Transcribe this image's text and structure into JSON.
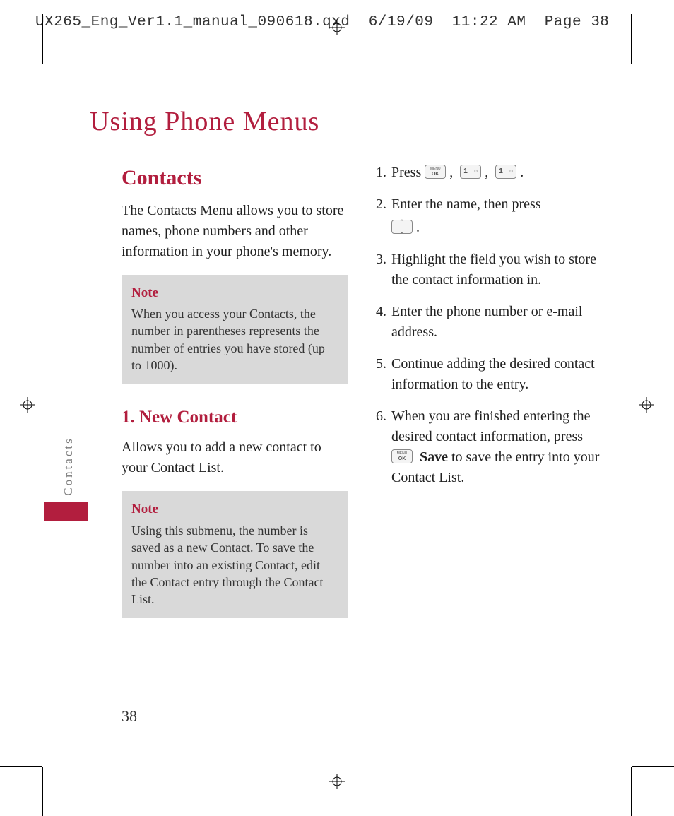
{
  "print_header": {
    "filename": "UX265_Eng_Ver1.1_manual_090618.qxd",
    "date": "6/19/09",
    "time": "11:22 AM",
    "page_label": "Page 38"
  },
  "chapter_title": "Using Phone Menus",
  "side_tab_label": "Contacts",
  "page_number": "38",
  "left_column": {
    "section_heading": "Contacts",
    "intro": "The Contacts Menu allows you to store names, phone numbers and other information in your phone's memory.",
    "note1_title": "Note",
    "note1_body": "When you access your Contacts, the number in parentheses represents the number of entries you have stored (up to 1000).",
    "subsection_heading": "1. New Contact",
    "subsection_intro": "Allows you to add a new contact to your Contact List.",
    "note2_title": "Note",
    "note2_body": "Using this submenu, the number is saved as a new Contact. To save the number into an existing Contact, edit the Contact entry through the Contact List."
  },
  "right_column": {
    "steps": [
      {
        "num": "1.",
        "pre": "Press ",
        "icons": [
          "ok",
          "one",
          "one"
        ],
        "post": "."
      },
      {
        "num": "2.",
        "text": "Enter the name, then press",
        "trailing_icon": "nav",
        "trailing_post": "."
      },
      {
        "num": "3.",
        "text": "Highlight the field you wish to store the contact information in."
      },
      {
        "num": "4.",
        "text": "Enter the phone number or e-mail address."
      },
      {
        "num": "5.",
        "text": "Continue adding the desired contact information to the entry."
      },
      {
        "num": "6.",
        "text_pre": "When you are finished entering the desired contact information, press ",
        "icon": "ok",
        "bold_after": "Save",
        "text_post": " to save the entry into your Contact List."
      }
    ]
  }
}
